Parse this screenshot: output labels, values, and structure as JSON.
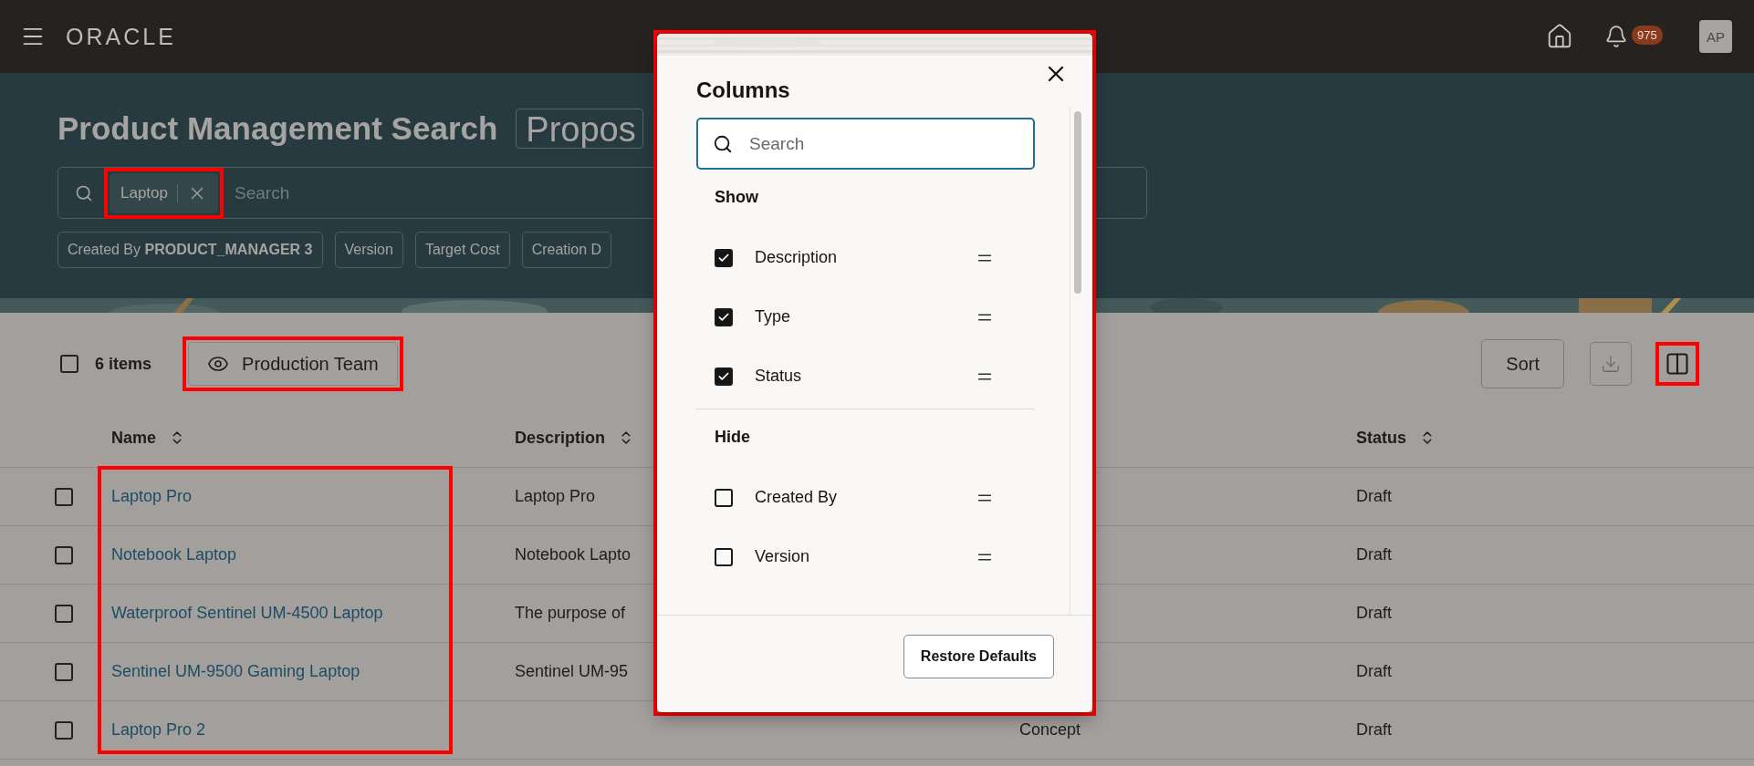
{
  "top_bar": {
    "brand": "ORACLE",
    "notification_count": "975",
    "avatar": "AP"
  },
  "header": {
    "title": "Product Management Search",
    "title_field": "Propos",
    "search": {
      "chips": [
        {
          "label": "Laptop",
          "highlighted": true
        }
      ],
      "placeholder": "Search"
    },
    "filters": [
      {
        "label": "Created By **PRODUCT_MANAGER 3**"
      },
      {
        "label": "Version"
      },
      {
        "label": "Target Cost"
      },
      {
        "label": "Creation D"
      }
    ]
  },
  "toolbar": {
    "select_all_checked": false,
    "count": "6 items",
    "view": {
      "label": "Production Team",
      "highlighted": true
    },
    "sort": "Sort",
    "columns_button_highlighted": true
  },
  "table": {
    "name_column_highlighted": true,
    "columns": [
      {
        "label": "Name"
      },
      {
        "label": "Description"
      },
      {
        "label": "Status"
      }
    ],
    "rows": [
      {
        "checked": false,
        "name": "Laptop Pro",
        "description": "Laptop Pro",
        "status": "Draft"
      },
      {
        "checked": false,
        "name": "Notebook Laptop",
        "description": "Notebook Lapto",
        "status": "Draft"
      },
      {
        "checked": false,
        "name": "Waterproof Sentinel UM-4500 Laptop",
        "description": "The purpose of",
        "status": "Draft"
      },
      {
        "checked": false,
        "name": "Sentinel UM-9500 Gaming Laptop",
        "description": "Sentinel UM-95",
        "status": "Draft"
      },
      {
        "checked": false,
        "name": "Laptop Pro 2",
        "type": "Concept",
        "status": "Draft"
      }
    ]
  },
  "dialog": {
    "title": "Columns",
    "highlighted": true,
    "search_placeholder": "Search",
    "sections": [
      {
        "heading": "Show",
        "items": [
          {
            "label": "Description",
            "checked": true
          },
          {
            "label": "Type",
            "checked": true
          },
          {
            "label": "Status",
            "checked": true
          }
        ]
      },
      {
        "heading": "Hide",
        "items": [
          {
            "label": "Created By",
            "checked": false
          },
          {
            "label": "Version",
            "checked": false
          }
        ]
      }
    ],
    "button": "Restore Defaults"
  }
}
